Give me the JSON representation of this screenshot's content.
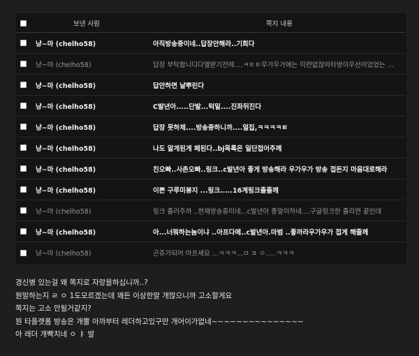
{
  "table": {
    "headers": {
      "sender": "보낸 사람",
      "content": "쪽지 내용"
    },
    "rows": [
      {
        "sender": "냥~마 (chelho58)",
        "content": "아직방송중이네..답장안해라..기회다",
        "read": false
      },
      {
        "sender": "냥~마 (chelho58)",
        "content": "답장 부탁합니다다열받기전에....ㅋㅌㅌ우가우가에는 미련없잖아타방이우선이었었는 것처럼",
        "read": true
      },
      {
        "sender": "냥~마 (chelho58)",
        "content": "답안하면 냘뿌린다",
        "read": false
      },
      {
        "sender": "냥~마 (chelho58)",
        "content": "C발년아.....단발...턱밑....진좌뒤진다",
        "read": false
      },
      {
        "sender": "냥~마 (chelho58)",
        "content": "답장 못하제....방송중하니까....얼집,ㅋㅋㅋㅋㅌ",
        "read": false
      },
      {
        "sender": "냥~마 (chelho58)",
        "content": "나도 알게된게 페된다..bj목록은 일단접어주께",
        "read": false
      },
      {
        "sender": "냥~마 (chelho58)",
        "content": "친오빠..사촌오빠..링크..c발년아 좋게 방송해라 우가우가 방송 접든지 마음대로해라",
        "read": false
      },
      {
        "sender": "냥~마 (chelho58)",
        "content": "이쁜 구루미봉지 ...링크.....16계링크졸졸께",
        "read": false
      },
      {
        "sender": "냥~마 (chelho58)",
        "content": "링크 졸러주까 ..현재방송중이네...c발년아 좋알이하네....구글링크한 졸리면 끝인데",
        "read": true
      },
      {
        "sender": "냥~마 (chelho58)",
        "content": "아...너뭐하는놈이냐 ..아프다메..c발년아.마범 ..좋까라우가우가 접게 해줄께",
        "read": false
      },
      {
        "sender": "냥~마 (chelho58)",
        "content": "곤쥬가되어 아프세요 ...ㅋㅋㅋ...ㅁ ㅍ ㅇ.....ㅋㅋㅋ",
        "read": true
      }
    ]
  },
  "comment": {
    "lines": [
      "경신병 있는걸 왜 쪽지로 자랑을하십니까..?",
      "뭔말하는지 ㄹ ㅇ 1도모르겠는데 꽤든 이상한말 개많으니까 고소할게요",
      "쪽지는 고소 안될거같지?",
      "뭔 타플랫폼 방송은 개뿔 아까부터 레더하고있구만 개어이가없네~~~~~~~~~~~~~~~",
      "아 레더 개빡치네 ㅇ ㅑ 발"
    ]
  },
  "colors": {
    "background": "#1e1e1e",
    "table_background": "#141414",
    "unread_text": "#f0f0f0",
    "read_text": "#9a9a9a"
  }
}
